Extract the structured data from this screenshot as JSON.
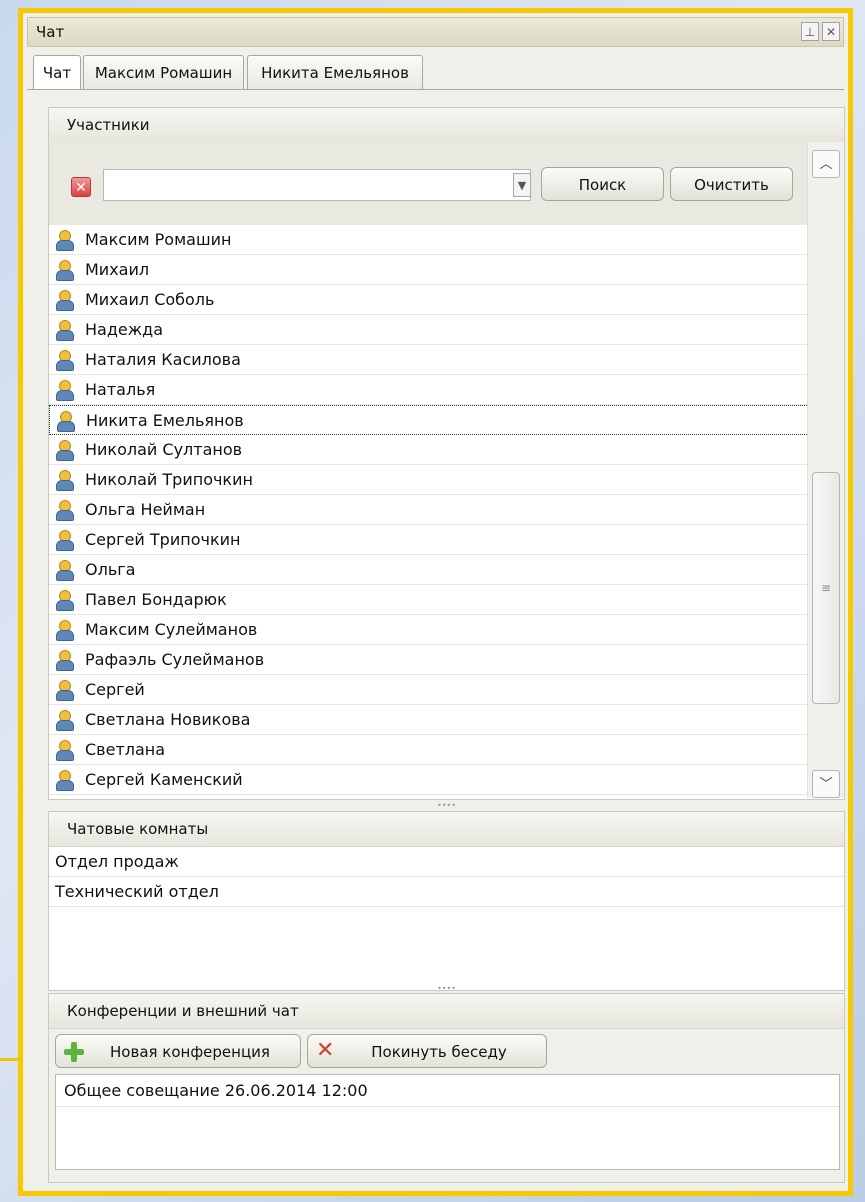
{
  "window": {
    "title": "Чат",
    "pin_glyph": "⊥",
    "close_glyph": "✕"
  },
  "tabs": [
    {
      "label": "Чат",
      "active": true
    },
    {
      "label": "Максим Ромашин",
      "active": false
    },
    {
      "label": "Никита Емельянов",
      "active": false
    }
  ],
  "participants": {
    "header": "Участники",
    "search": {
      "value": "",
      "placeholder": "",
      "search_label": "Поиск",
      "clear_label": "Очистить"
    },
    "users": [
      "Максим Ромашин",
      "Михаил",
      "Михаил Соболь",
      "Надежда",
      "Наталия Касилова",
      "Наталья",
      "Никита Емельянов",
      "Николай Султанов",
      "Николай Трипочкин",
      "Ольга Нейман",
      "Сергей Трипочкин",
      "Ольга",
      "Павел Бондарюк",
      "Максим  Сулейманов",
      "Рафаэль Сулейманов",
      "Сергей",
      "Светлана Новикова",
      "Светлана",
      "Сергей Каменский"
    ],
    "selected_user": "Никита Емельянов"
  },
  "rooms": {
    "header": "Чатовые комнаты",
    "items": [
      "Отдел продаж",
      "Технический отдел"
    ]
  },
  "conferences": {
    "header": "Конференции и внешний чат",
    "new_label": "Новая конференция",
    "leave_label": "Покинуть беседу",
    "items": [
      "Общее совещание 26.06.2014 12:00"
    ]
  },
  "icons": {
    "user": "user-icon",
    "clear": "clear-search-icon",
    "add": "plus-icon",
    "leave": "red-x-icon"
  },
  "colors": {
    "window_border": "#f7c900",
    "selected_row_border": "#333333"
  }
}
